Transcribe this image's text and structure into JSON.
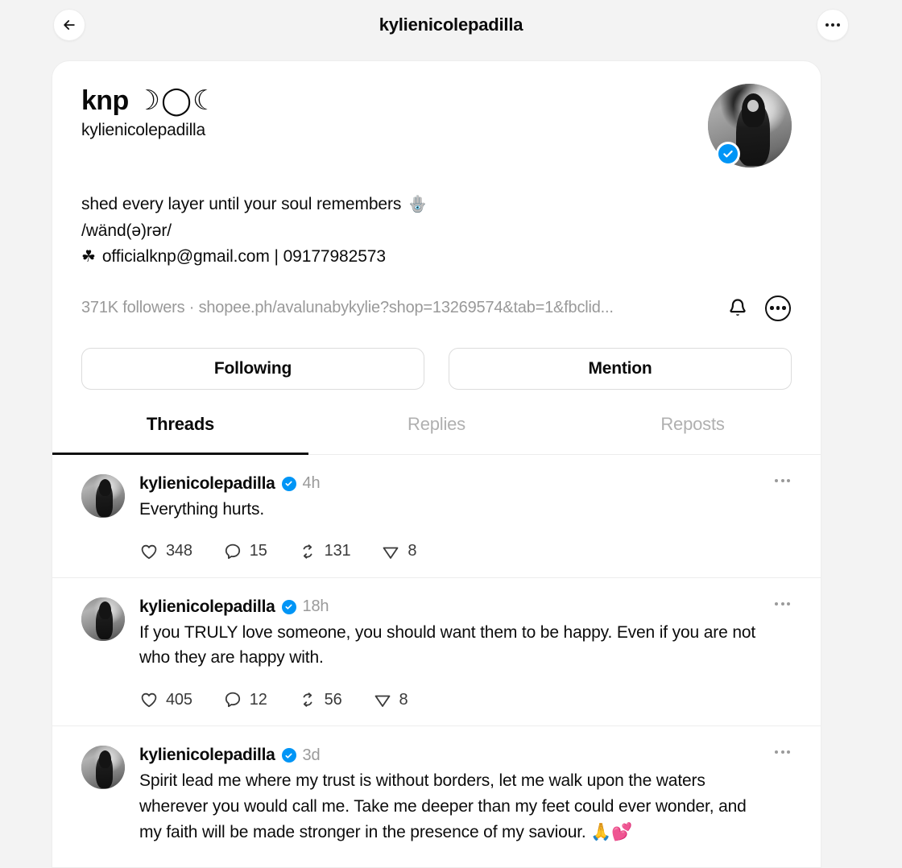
{
  "topbar": {
    "back_label": "back-arrow",
    "title": "kylienicolepadilla",
    "more_label": "more-options"
  },
  "profile": {
    "display_name": "knp",
    "display_name_symbols": "☽◯☾",
    "handle": "kylienicolepadilla",
    "verified": true,
    "bio": [
      {
        "text": "shed every layer until your soul remembers",
        "emoji": "🪬"
      },
      {
        "text": "/wänd(ə)rər/",
        "emoji": ""
      },
      {
        "text": "officialknp@gmail.com | 09177982573",
        "emoji": "",
        "prefix_emoji": "☘"
      }
    ],
    "followers": "371K followers",
    "separator": "·",
    "link": "shopee.ph/avalunabykylie?shop=13269574&tab=1&fbclid...",
    "notify_icon": "bell-icon",
    "more_icon": "more-circle-icon"
  },
  "action_buttons": {
    "following": "Following",
    "mention": "Mention"
  },
  "tabs": [
    {
      "label": "Threads",
      "active": true
    },
    {
      "label": "Replies",
      "active": false
    },
    {
      "label": "Reposts",
      "active": false
    }
  ],
  "posts": [
    {
      "username": "kylienicolepadilla",
      "verified": true,
      "time": "4h",
      "text": "Everything hurts.",
      "likes": "348",
      "replies": "15",
      "reposts": "131",
      "shares": "8"
    },
    {
      "username": "kylienicolepadilla",
      "verified": true,
      "time": "18h",
      "text": "If you TRULY love someone, you should want them to be happy. Even if you are not who they are happy with.",
      "likes": "405",
      "replies": "12",
      "reposts": "56",
      "shares": "8"
    },
    {
      "username": "kylienicolepadilla",
      "verified": true,
      "time": "3d",
      "text": "Spirit lead me where my trust is without borders, let me walk upon the waters wherever you would call me. Take me deeper than my feet could ever wonder, and my faith will be made stronger in the presence of my saviour. 🙏💕",
      "likes": "",
      "replies": "",
      "reposts": "",
      "shares": ""
    }
  ],
  "colors": {
    "background": "#f3f3f3",
    "card": "#ffffff",
    "verified_blue": "#0095f6",
    "text_primary": "#0a0a0a",
    "text_muted": "#9a9a9a",
    "divider": "#ededed"
  }
}
